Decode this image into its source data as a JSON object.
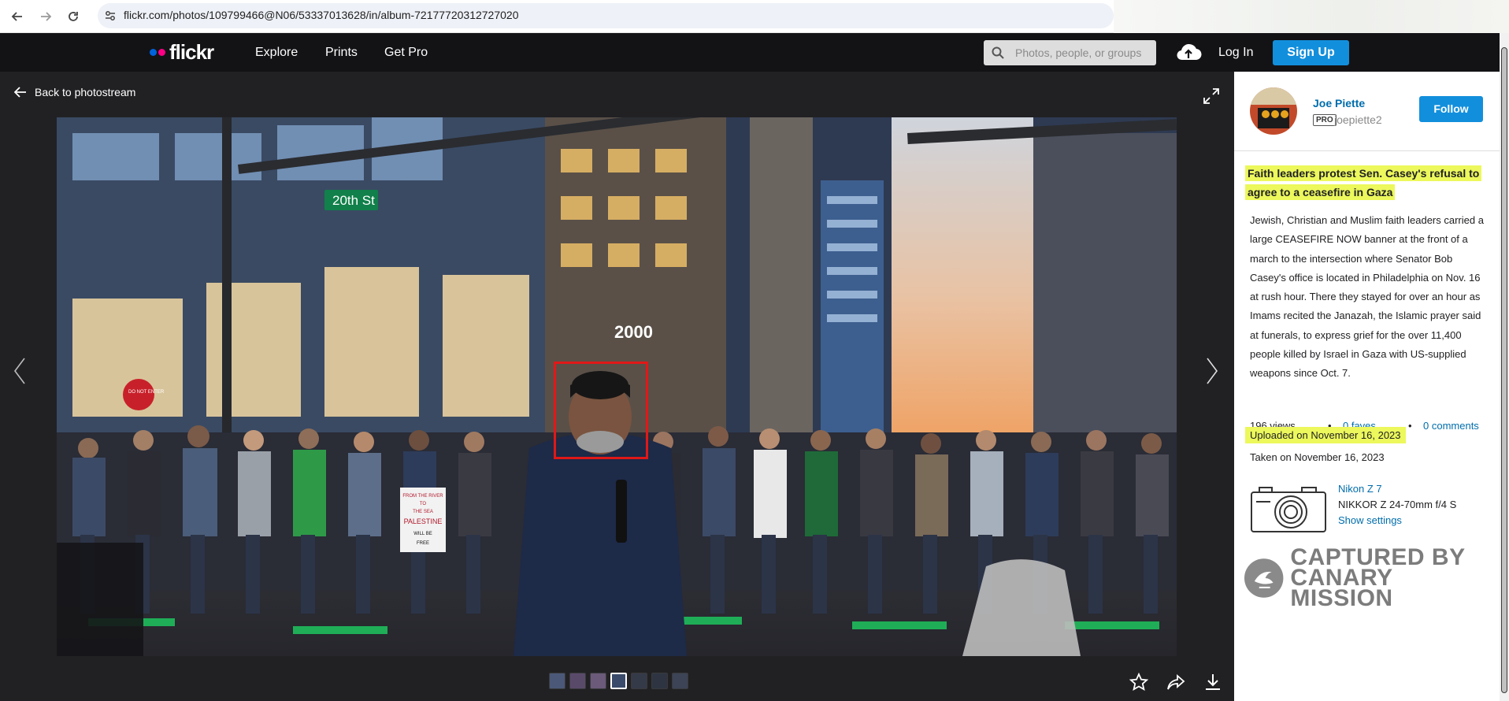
{
  "browser": {
    "url": "flickr.com/photos/109799466@N06/53337013628/in/album-72177720312727020"
  },
  "header": {
    "logo_text": "flickr",
    "nav": [
      "Explore",
      "Prints",
      "Get Pro"
    ],
    "search_placeholder": "Photos, people, or groups",
    "login_label": "Log In",
    "signup_label": "Sign Up"
  },
  "viewer": {
    "back_label": "Back to photostream",
    "thumbnail_count": 7
  },
  "photo": {
    "signs": [
      "20th St",
      "2000",
      "DO NOT ENTER"
    ],
    "placard_lines": [
      "FROM THE RIVER",
      "TO",
      "THE SEA",
      "PALESTINE",
      "WILL BE",
      "FREE"
    ]
  },
  "sidebar": {
    "author_name": "Joe Piette",
    "pro_badge": "PRO",
    "username": "joepiette2",
    "follow_label": "Follow",
    "title": "Faith leaders protest Sen. Casey's refusal to agree to a ceasefire in Gaza",
    "description": "Jewish, Christian and Muslim faith leaders carried a large CEASEFIRE NOW banner at the front of a march to the intersection where Senator Bob Casey's office is located in Philadelphia on Nov. 16 at rush hour. There they stayed for over an hour as Imams recited the Janazah, the Islamic prayer said at funerals, to express grief for the over 11,400 people killed by Israel in Gaza with US-supplied weapons since Oct. 7.",
    "views": "196 views",
    "faves": "0 faves",
    "comments": "0 comments",
    "uploaded": "Uploaded on November 16, 2023",
    "taken": "Taken on November 16, 2023",
    "camera_model": "Nikon Z 7",
    "lens": "NIKKOR Z 24-70mm f/4 S",
    "show_settings": "Show settings",
    "watermark_line1": "CAPTURED BY",
    "watermark_line2": "CANARY MISSION"
  },
  "colors": {
    "accent_blue": "#128fdc",
    "link_blue": "#006dac",
    "highlight_yellow": "#ecf85b",
    "header_black": "#131316",
    "viewer_bg": "#212124",
    "face_box_red": "#e01818"
  }
}
